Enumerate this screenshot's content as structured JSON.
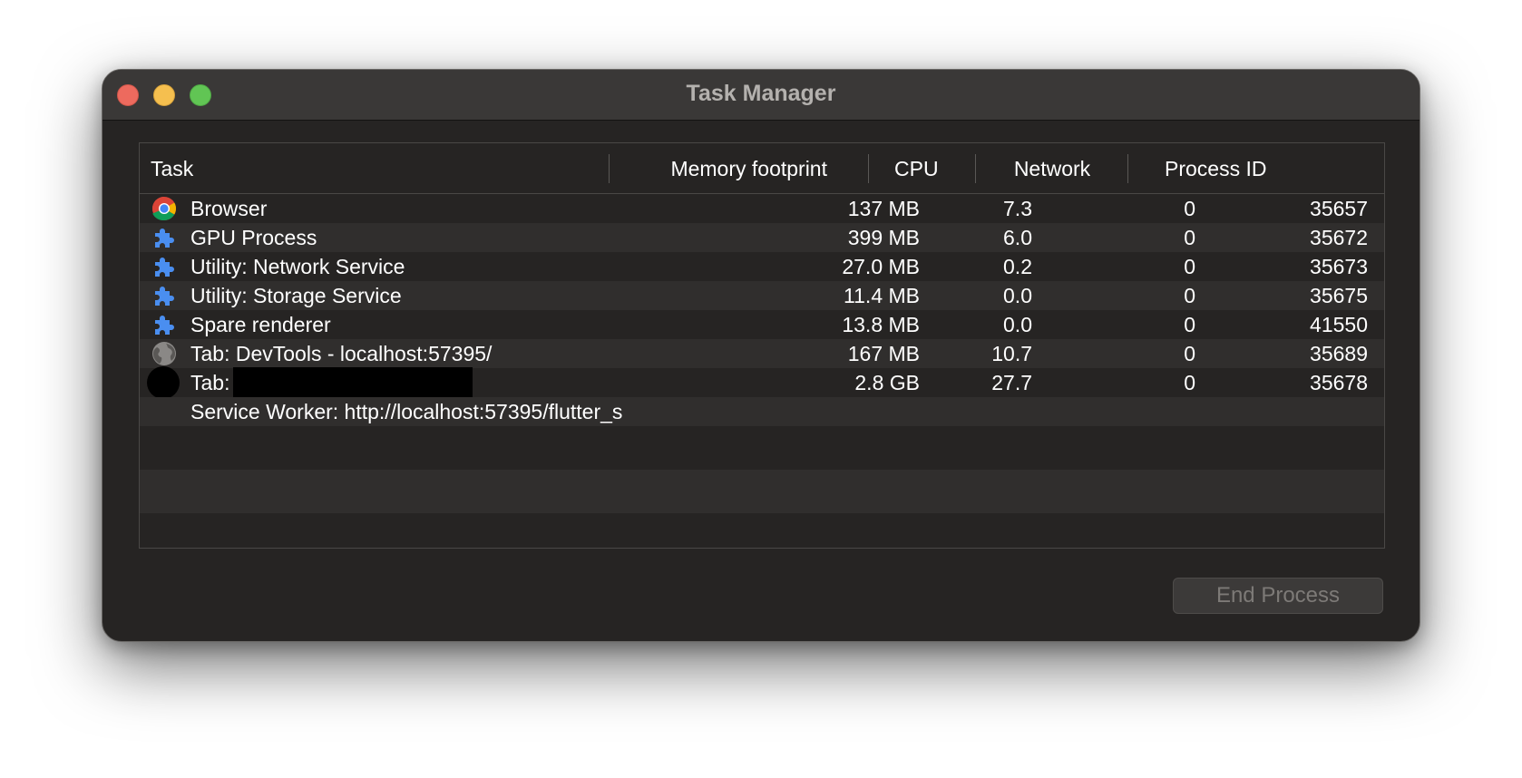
{
  "window": {
    "title": "Task Manager"
  },
  "table": {
    "columns": [
      "Task",
      "Memory footprint",
      "CPU",
      "Network",
      "Process ID"
    ],
    "rows": [
      {
        "icon": "chrome-icon",
        "task": "Browser",
        "memory": "137 MB",
        "cpu": "7.3",
        "network": "0",
        "pid": "35657"
      },
      {
        "icon": "puzzle-icon",
        "task": "GPU Process",
        "memory": "399 MB",
        "cpu": "6.0",
        "network": "0",
        "pid": "35672"
      },
      {
        "icon": "puzzle-icon",
        "task": "Utility: Network Service",
        "memory": "27.0 MB",
        "cpu": "0.2",
        "network": "0",
        "pid": "35673"
      },
      {
        "icon": "puzzle-icon",
        "task": "Utility: Storage Service",
        "memory": "11.4 MB",
        "cpu": "0.0",
        "network": "0",
        "pid": "35675"
      },
      {
        "icon": "puzzle-icon",
        "task": "Spare renderer",
        "memory": "13.8 MB",
        "cpu": "0.0",
        "network": "0",
        "pid": "41550"
      },
      {
        "icon": "globe-icon",
        "task": "Tab: DevTools - localhost:57395/",
        "memory": "167 MB",
        "cpu": "10.7",
        "network": "0",
        "pid": "35689"
      },
      {
        "icon": "redacted-favicon-icon",
        "task": "Tab:",
        "memory": "2.8 GB",
        "cpu": "27.7",
        "network": "0",
        "pid": "35678"
      },
      {
        "icon": "",
        "task": "Service Worker: http://localhost:57395/flutter_s",
        "memory": "",
        "cpu": "",
        "network": "",
        "pid": ""
      }
    ]
  },
  "buttons": {
    "end_process": "End Process"
  },
  "colors": {
    "window_bg": "#262423",
    "titlebar_bg": "#3a3837",
    "close": "#ed6a5e",
    "minimize": "#f5bf4f",
    "maximize": "#61c554",
    "puzzle_blue": "#4a8ef0"
  }
}
